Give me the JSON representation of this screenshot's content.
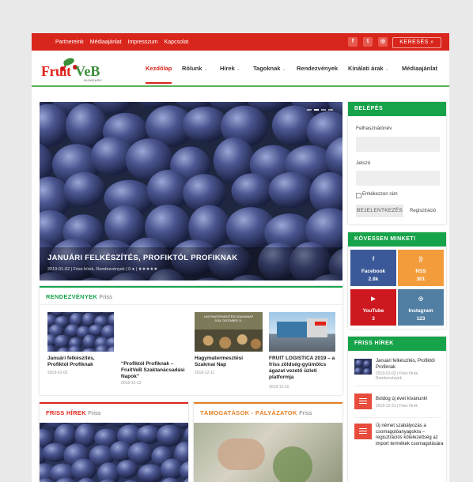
{
  "topbar": {
    "links": [
      "Partnereink",
      "Médiaajánlat",
      "Impresszum",
      "Kapcsolat"
    ],
    "social": [
      {
        "icon": "facebook-icon",
        "glyph": "f"
      },
      {
        "icon": "twitter-icon",
        "glyph": "t"
      },
      {
        "icon": "instagram-icon",
        "glyph": "◎"
      }
    ],
    "search_label": "KERESÉS",
    "search_glyph": "⌕"
  },
  "logo": {
    "part1": "Fruit",
    "part2": "VeB",
    "sub": "HUNGARY"
  },
  "nav": [
    {
      "label": "Kezdőlap",
      "active": true,
      "chevron": false
    },
    {
      "label": "Rólunk",
      "chevron": true
    },
    {
      "label": "Hírek",
      "chevron": true
    },
    {
      "label": "Tagoknak",
      "chevron": true
    },
    {
      "label": "Rendezvények",
      "chevron": false
    },
    {
      "label": "Kínálati árak",
      "chevron": true
    },
    {
      "label": "Médiaajánlat",
      "chevron": false
    }
  ],
  "chevron_glyph": "⌄",
  "hero": {
    "title": "JANUÁRI FELKÉSZÍTÉS, PROFIKTÓL PROFIKNAK",
    "meta": "2019-01-02 | Friss hírek, Rendezvények | 0 ● | ★★★★★"
  },
  "events": {
    "title": "RENDEZVÉNYEK",
    "subtitle": "Friss",
    "accent": "#17a34a",
    "cards": [
      {
        "title": "Januári felkészítés, Profiktól Profiknak",
        "date": "2019-01-02"
      },
      {
        "title": "“Profiktól Profiknak – FruitVeB Szaktanácsadási Napok”",
        "date": "2018-12-13"
      },
      {
        "title": "Hagymatermesztési Szakmai Nap",
        "date": "2018-12-11",
        "image_text": "HAGYMATERMESZTÉSI SZAKMANAP\n2018. DECEMBER 11."
      },
      {
        "title": "FRUIT LOGISTICA 2019 – a friss zöldség-gyümölcs ágazat vezető üzleti platformja",
        "date": "2018-12-10"
      }
    ]
  },
  "friss": {
    "title": "FRISS HÍREK",
    "subtitle": "Friss",
    "accent": "#e2231a"
  },
  "tamogatas": {
    "title": "TÁMOGATÁSOK - PÁLYÁZATOK",
    "subtitle": "Friss",
    "accent": "#e67e22"
  },
  "login": {
    "title": "BELÉPÉS",
    "user_label": "Felhasználónév",
    "pass_label": "Jelszó",
    "remember": "Emlékezzen rám",
    "submit": "BEJELENTKEZÉS",
    "register": "Regisztráció"
  },
  "follow": {
    "title": "KÖVESSEN MINKET!",
    "tiles": [
      {
        "name": "Facebook",
        "count": "2.8k",
        "icon": "facebook-icon",
        "glyph": "f",
        "color": "#3b5998"
      },
      {
        "name": "RSS",
        "count": "301",
        "icon": "rss-icon",
        "glyph": "))",
        "color": "#f39c3c"
      },
      {
        "name": "YouTube",
        "count": "3",
        "icon": "youtube-icon",
        "glyph": "▶",
        "color": "#cc181e"
      },
      {
        "name": "Instagram",
        "count": "123",
        "icon": "instagram-icon",
        "glyph": "◎",
        "color": "#517fa4"
      }
    ]
  },
  "side_news": {
    "title": "FRISS HÍREK",
    "items": [
      {
        "title": "Januári felkészítés, Profiktól Profiknak",
        "meta": "2019-01-02 | Friss hírek, Rendezvények"
      },
      {
        "title": "Boldog új évet kívánunk!",
        "meta": "2018-12-31 | Friss hírek"
      },
      {
        "title": "Új német szabályozás a csomagolóanyagokra – regisztrációs kötelezettség az import termékek csomagolására",
        "meta": ""
      }
    ]
  }
}
